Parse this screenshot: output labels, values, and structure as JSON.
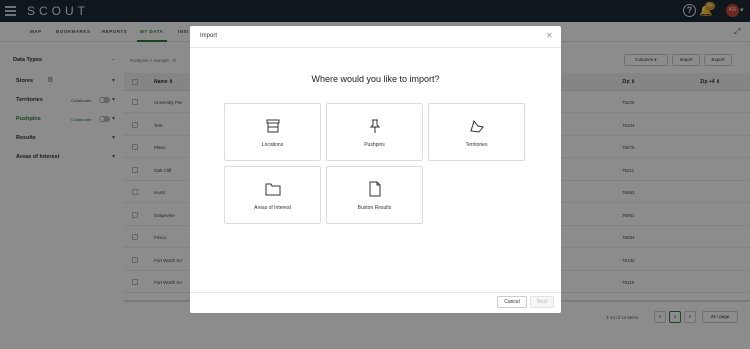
{
  "app": {
    "logo": "SCOUT"
  },
  "topbar": {
    "help": "?",
    "notification_count": "9+",
    "avatar_initials": "KR"
  },
  "nav": {
    "tabs": [
      "MAP",
      "BOOKMARKS",
      "REPORTS",
      "MY DATA",
      "INSI"
    ],
    "active_tab": "MY DATA"
  },
  "sidebar": {
    "title": "Data Types",
    "items": [
      {
        "label": "Stores"
      },
      {
        "label": "Territories",
        "collab": "Collaborate"
      },
      {
        "label": "Pushpins",
        "collab": "Collaborate"
      },
      {
        "label": "Results"
      },
      {
        "label": "Areas of Interest"
      }
    ]
  },
  "main": {
    "breadcrumb": "Pushpins  >  Sample - R",
    "toolbar": {
      "columns": "Columns",
      "import": "Import",
      "export": "Export"
    },
    "columns": {
      "name": "Name",
      "zip": "Zip",
      "zip4": "Zip +4"
    },
    "rows": [
      {
        "name": "University Par",
        "zip": "75225"
      },
      {
        "name": "Test",
        "zip": "76104"
      },
      {
        "name": "Plano",
        "zip": "75075"
      },
      {
        "name": "Oak Cliff",
        "zip": "75211"
      },
      {
        "name": "Hurst",
        "zip": "76053"
      },
      {
        "name": "Grapevine",
        "zip": "76051"
      },
      {
        "name": "Frisco",
        "zip": "75034"
      },
      {
        "name": "Fort Worth So",
        "zip": "76132"
      },
      {
        "name": "Fort Worth So",
        "zip": "76115"
      }
    ],
    "pager": {
      "summary": "1-14 of 14 items",
      "prev": "<",
      "page": "1",
      "next": ">",
      "per_page": "25 / page"
    }
  },
  "modal": {
    "title": "Import",
    "question": "Where would you like to import?",
    "options": [
      {
        "label": "Locations",
        "icon": "store-icon"
      },
      {
        "label": "Pushpins",
        "icon": "pushpin-icon"
      },
      {
        "label": "Territories",
        "icon": "territory-icon"
      },
      {
        "label": "Areas of Interest",
        "icon": "folder-icon"
      },
      {
        "label": "Buxton Results",
        "icon": "document-icon"
      }
    ],
    "cancel_label": "Cancel",
    "next_label": "Next"
  }
}
